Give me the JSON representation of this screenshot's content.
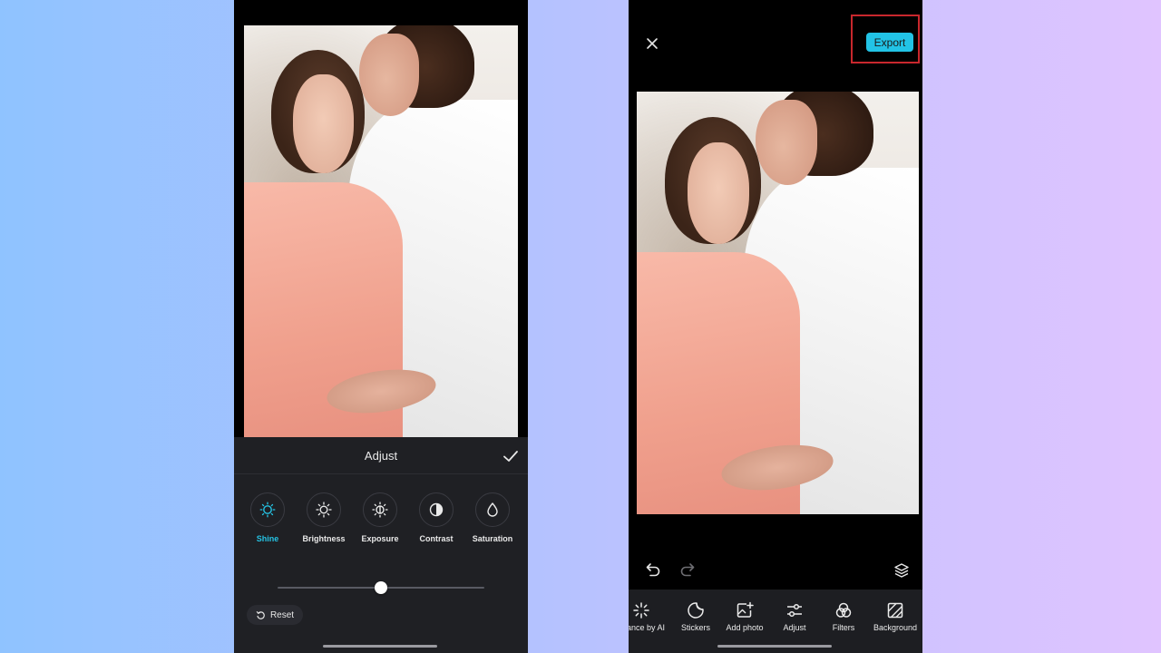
{
  "left_phone": {
    "adjust_panel": {
      "title": "Adjust",
      "tools": [
        {
          "label": "Shine",
          "icon": "sun-outline-icon",
          "active": true
        },
        {
          "label": "Brightness",
          "icon": "sun-icon",
          "active": false
        },
        {
          "label": "Exposure",
          "icon": "exposure-icon",
          "active": false
        },
        {
          "label": "Contrast",
          "icon": "contrast-icon",
          "active": false
        },
        {
          "label": "Saturation",
          "icon": "drop-icon",
          "active": false
        }
      ],
      "slider_value_fraction": 0.5,
      "reset_label": "Reset"
    }
  },
  "right_phone": {
    "export_label": "Export",
    "toolbar": [
      {
        "label": "ance by AI",
        "icon": "sparkle-icon"
      },
      {
        "label": "Stickers",
        "icon": "sticker-icon"
      },
      {
        "label": "Add photo",
        "icon": "add-photo-icon"
      },
      {
        "label": "Adjust",
        "icon": "sliders-icon"
      },
      {
        "label": "Filters",
        "icon": "filters-icon"
      },
      {
        "label": "Background",
        "icon": "background-icon"
      }
    ]
  },
  "colors": {
    "accent": "#22c3e6",
    "highlight": "#c8272d",
    "panel": "#1f2024"
  }
}
